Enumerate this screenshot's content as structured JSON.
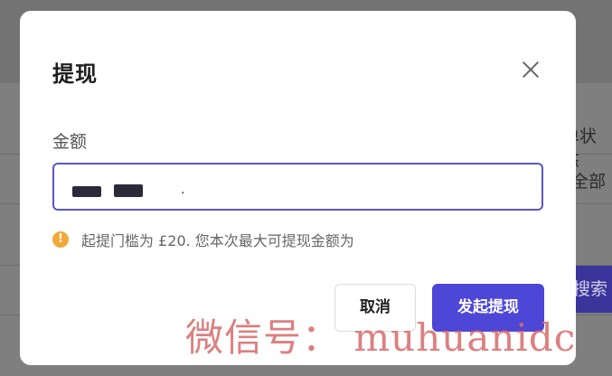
{
  "background": {
    "header_partial": "单状态",
    "filter_value_partial": "全部",
    "search_button_partial": "搜索"
  },
  "modal": {
    "title": "提现",
    "amount_label": "金额",
    "amount_value_suffix": ".",
    "hint_icon": "warning-icon",
    "hint_text": "起提门槛为 £20. 您本次最大可提现金额为",
    "cancel_label": "取消",
    "submit_label": "发起提现",
    "accent_color": "#4d46d6",
    "warning_color": "#f2a93b"
  },
  "watermark": {
    "text": "微信号： muhuanidc"
  }
}
